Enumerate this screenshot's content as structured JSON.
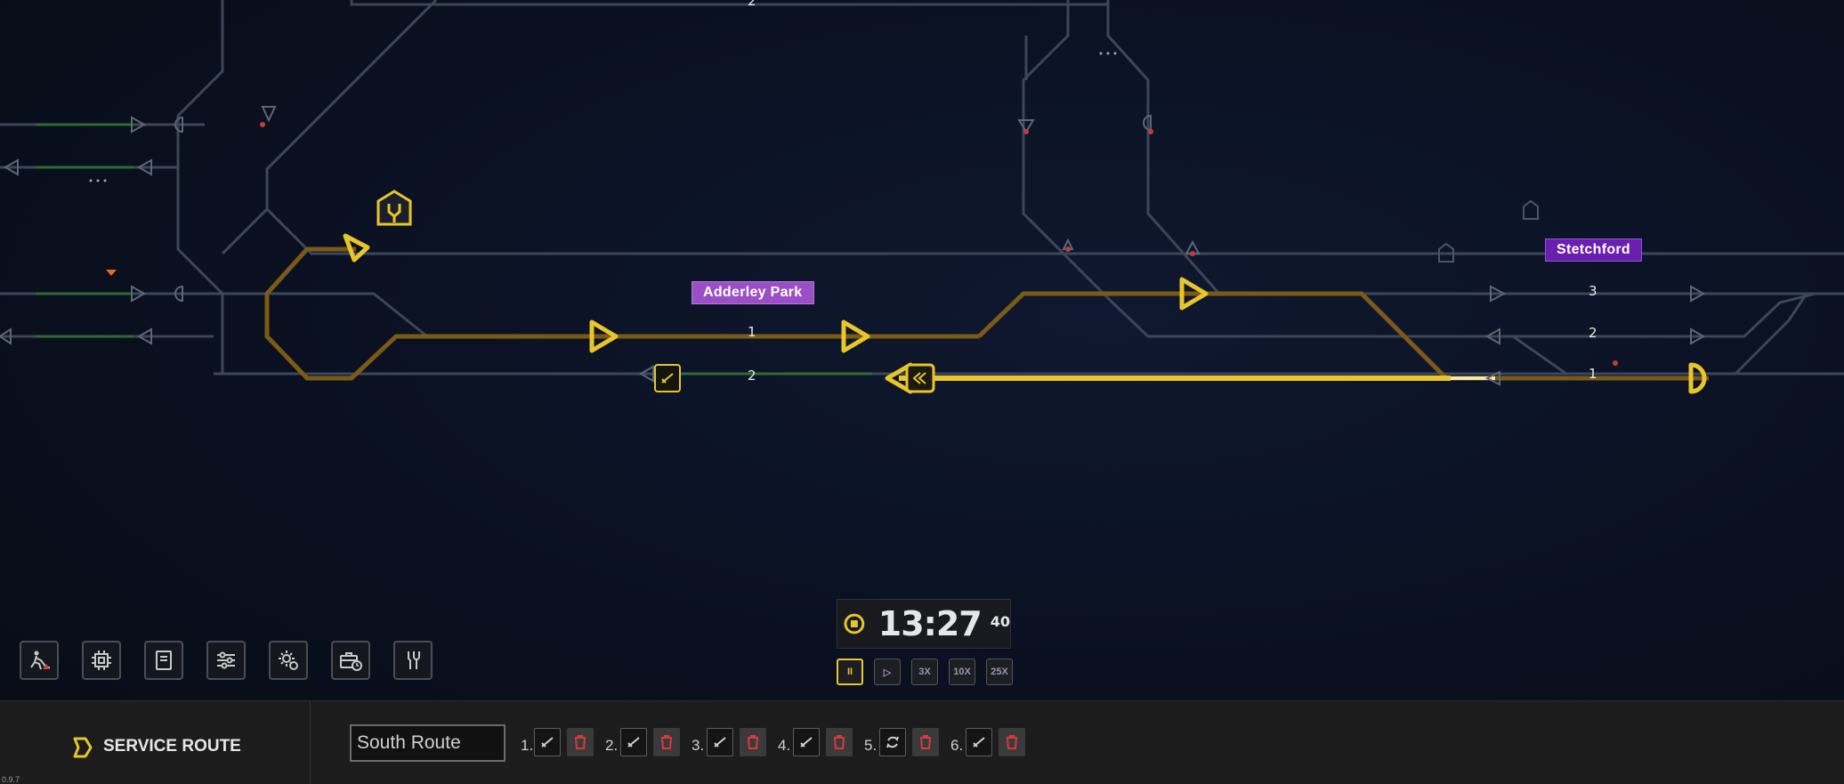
{
  "map": {
    "stations": [
      {
        "name": "Adderley Park",
        "color": "#9b4fc7"
      },
      {
        "name": "Stetchford",
        "color": "#6a1fb0"
      }
    ],
    "platforms_adderley": [
      "1",
      "2"
    ],
    "platforms_stetchford": [
      "3",
      "2",
      "1"
    ],
    "top_fragment": "2"
  },
  "clock": {
    "time": "13:27",
    "seconds": "40"
  },
  "speed_controls": {
    "pause_label": "II",
    "play_label": "▷",
    "speed_3x": "3X",
    "speed_10x": "10X",
    "speed_25x": "25X"
  },
  "toolbar": {
    "buttons": [
      {
        "icon": "construction-icon"
      },
      {
        "icon": "chip-icon"
      },
      {
        "icon": "book-icon"
      },
      {
        "icon": "sliders-icon"
      },
      {
        "icon": "gear-settings-icon"
      },
      {
        "icon": "briefcase-clock-icon"
      },
      {
        "icon": "tools-icon"
      }
    ]
  },
  "route_panel": {
    "title": "SERVICE ROUTE",
    "route_name": "South Route",
    "stops": [
      {
        "num": "1.",
        "icon": "pass-icon"
      },
      {
        "num": "2.",
        "icon": "pass-icon"
      },
      {
        "num": "3.",
        "icon": "pass-icon"
      },
      {
        "num": "4.",
        "icon": "pass-icon"
      },
      {
        "num": "5.",
        "icon": "reverse-icon"
      },
      {
        "num": "6.",
        "icon": "pass-icon"
      }
    ],
    "accent": "#e7c52b",
    "delete_color": "#d83a3a"
  },
  "version": "0.9.7"
}
